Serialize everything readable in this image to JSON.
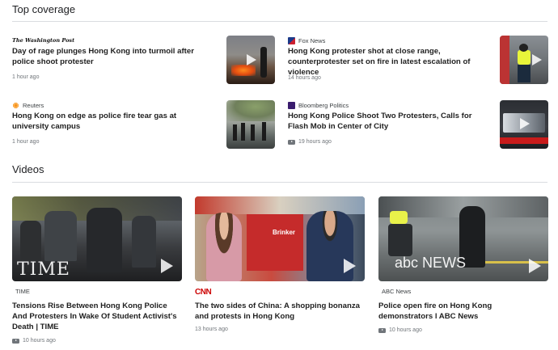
{
  "sections": {
    "top_coverage": "Top coverage",
    "videos": "Videos"
  },
  "stories": [
    {
      "source": "The Washington Post",
      "headline": "Day of rage plunges Hong Kong into turmoil after police shoot protester",
      "time": "1 hour ago",
      "thumb_icon": "play-icon",
      "logo_icon": "washington-post-logo"
    },
    {
      "source": "Fox News",
      "headline": "Hong Kong protester shot at close range, counterprotester set on fire in latest escalation of violence",
      "time": "14 hours ago",
      "logo_icon": "fox-news-logo"
    },
    {
      "source": "Reuters",
      "headline": "Hong Kong on edge as police fire tear gas at university campus",
      "time": "1 hour ago",
      "logo_icon": "reuters-logo"
    },
    {
      "source": "Bloomberg Politics",
      "headline": "Hong Kong Police Shoot Two Protesters, Calls for Flash Mob in Center of City",
      "time": "19 hours ago",
      "logo_icon": "bloomberg-logo"
    }
  ],
  "videos": [
    {
      "source": "TIME",
      "headline": "Tensions Rise Between Hong Kong Police And Protesters In Wake Of Student Activist's Death | TIME",
      "time": "10 hours ago",
      "watermark": "TIME"
    },
    {
      "source": "CNN",
      "headline": "The two sides of China: A shopping bonanza and protests in Hong Kong",
      "time": "13 hours ago",
      "banner_text": "Brinker"
    },
    {
      "source": "ABC News",
      "headline": "Police open fire on Hong Kong demonstrators l ABC News",
      "time": "10 hours ago",
      "watermark": "abc NEWS"
    }
  ],
  "colors": {
    "fox_blue": "#1b3a8a",
    "reuters_orange": "#f7941d",
    "bloomberg_purple": "#3a1c6e",
    "time_red": "#e90606",
    "abc_navy": "#1c2f59"
  }
}
